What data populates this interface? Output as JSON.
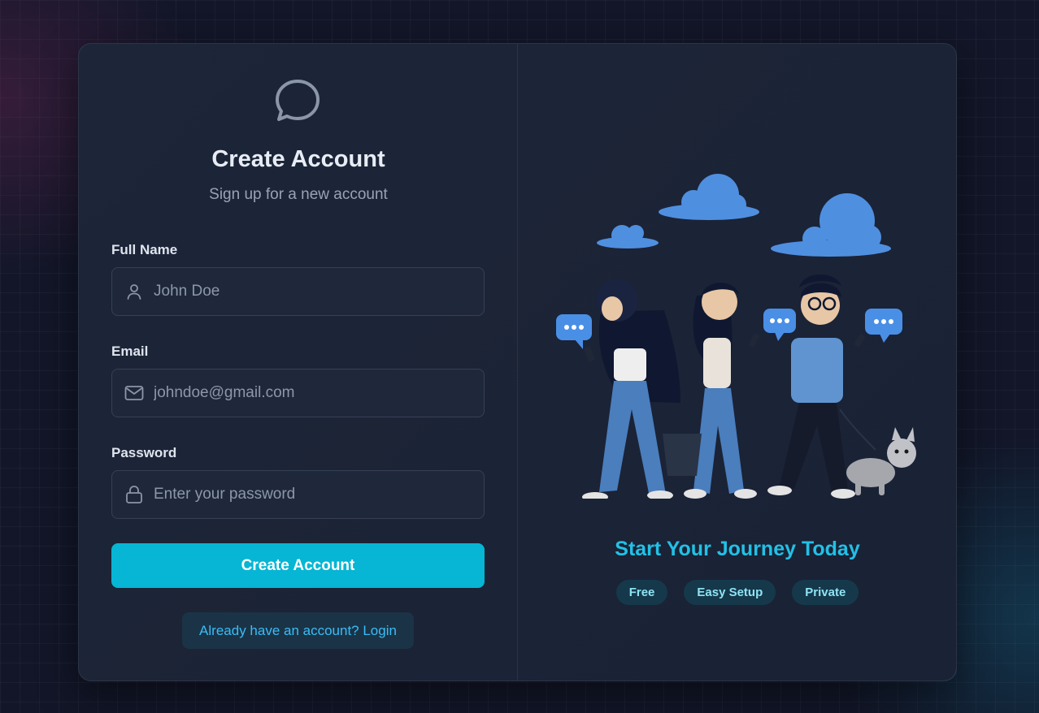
{
  "header": {
    "logo_icon": "chat-bubble-icon",
    "title": "Create Account",
    "subtitle": "Sign up for a new account"
  },
  "form": {
    "full_name": {
      "label": "Full Name",
      "placeholder": "John Doe",
      "icon": "user-icon"
    },
    "email": {
      "label": "Email",
      "placeholder": "johndoe@gmail.com",
      "icon": "mail-icon"
    },
    "password": {
      "label": "Password",
      "placeholder": "Enter your password",
      "icon": "lock-icon"
    },
    "submit_label": "Create Account",
    "login_link_label": "Already have an account? Login"
  },
  "promo": {
    "illustration": "people-walking-with-phones-illustration",
    "heading": "Start Your Journey Today",
    "badges": [
      "Free",
      "Easy Setup",
      "Private"
    ]
  },
  "colors": {
    "accent": "#06b6d4",
    "accent_text": "#22c1e6",
    "card_bg": "#1d2538",
    "page_bg": "#121628"
  }
}
